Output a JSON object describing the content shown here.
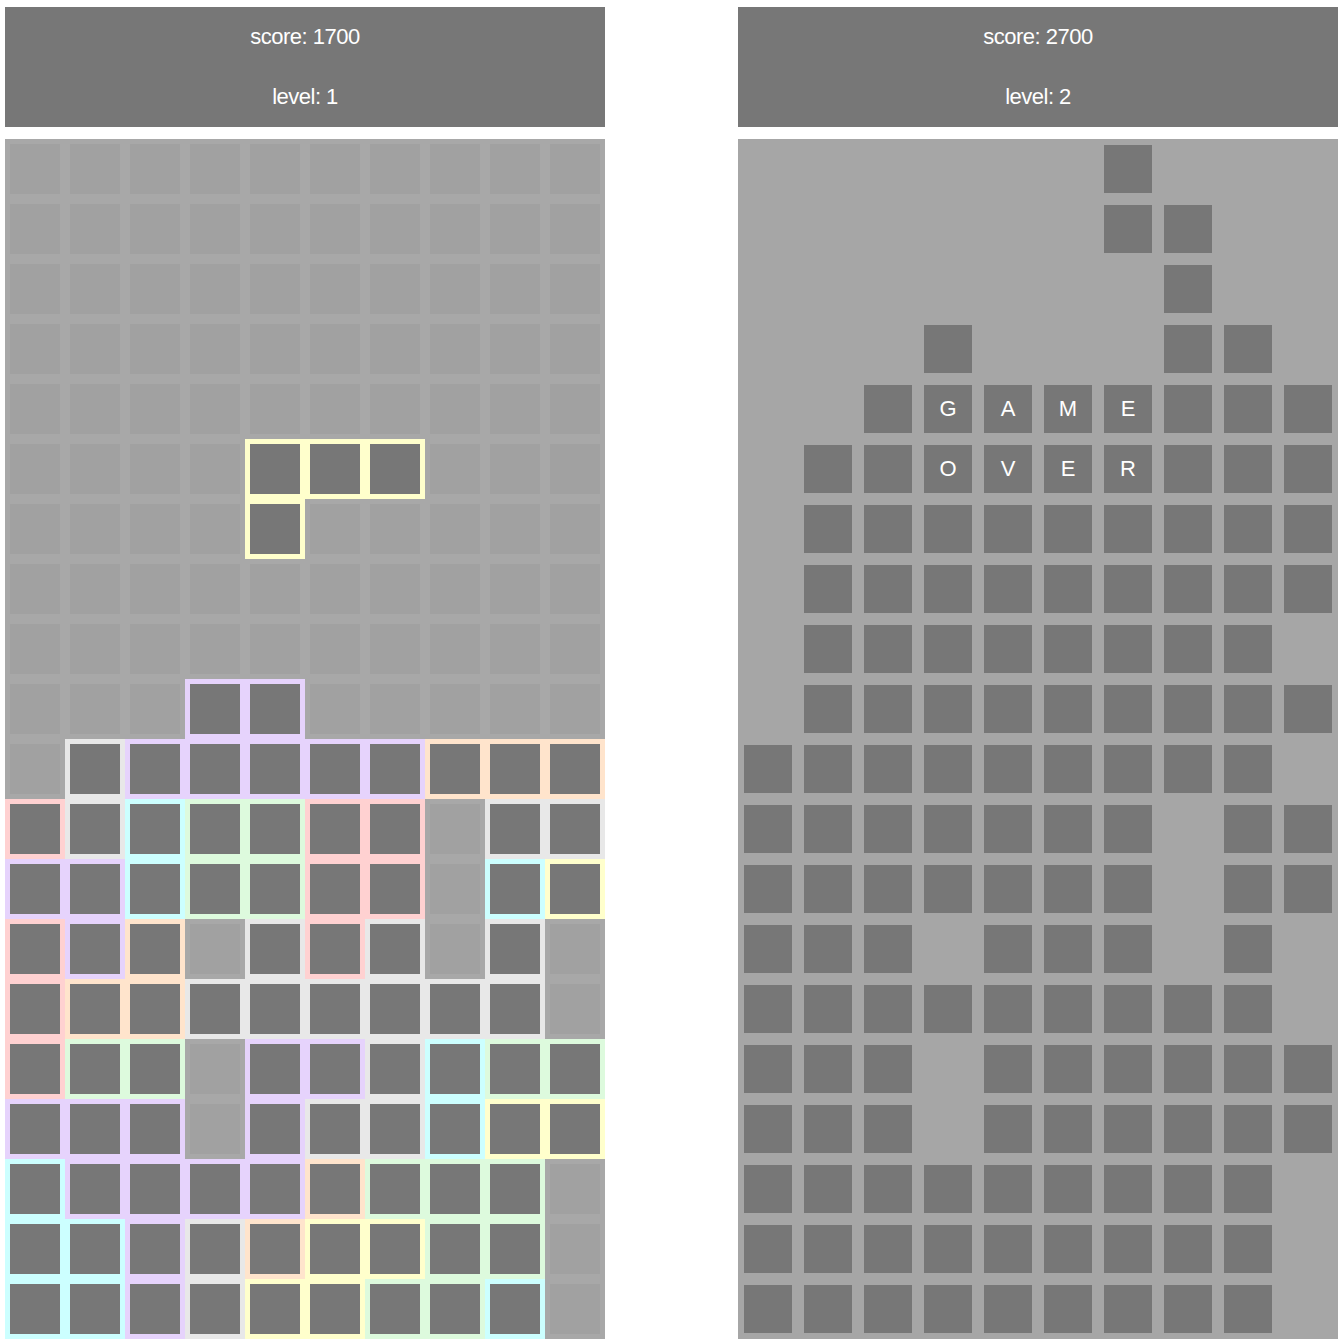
{
  "boards": [
    {
      "score": "score: 1700",
      "level": "level: 1",
      "game_over": false,
      "message": [],
      "grid": [
        "..........",
        "..........",
        "..........",
        "..........",
        "..........",
        "....YYY...",
        "....Y.....",
        "..........",
        "..........",
        "...PP.....",
        ".WPPPPPOOO",
        "RWCGGRR.WW",
        "PPCGGRR.CY",
        "RPO.WRW.W.",
        "ROOWWWWWW.",
        "RGG.PPWCGG",
        "PPP.PWWCYY",
        "CPPPPOGGG.",
        "CCPWOYYGG.",
        "CCPWYYGGC."
      ]
    },
    {
      "score": "score: 2700",
      "level": "level: 2",
      "game_over": true,
      "message": [
        "GAME",
        "OVER"
      ],
      "grid": [
        "......#...",
        "......##..",
        ".......#..",
        "...#...##.",
        "..########",
        ".#########",
        ".#########",
        ".#########",
        ".########.",
        ".#########",
        "#########.",
        "#######.##",
        "#######.##",
        "###.###.#.",
        "#########.",
        "###.######",
        "###.######",
        "#########.",
        "#########.",
        "#########."
      ]
    }
  ],
  "palette": {
    "P": "#e6d3fc",
    "W": "#e8e8e8",
    "O": "#ffe4cc",
    "R": "#ffd1d1",
    "C": "#ccffff",
    "G": "#ddfadd",
    "Y": "#ffffcc",
    "#": "#a6a6a6"
  }
}
